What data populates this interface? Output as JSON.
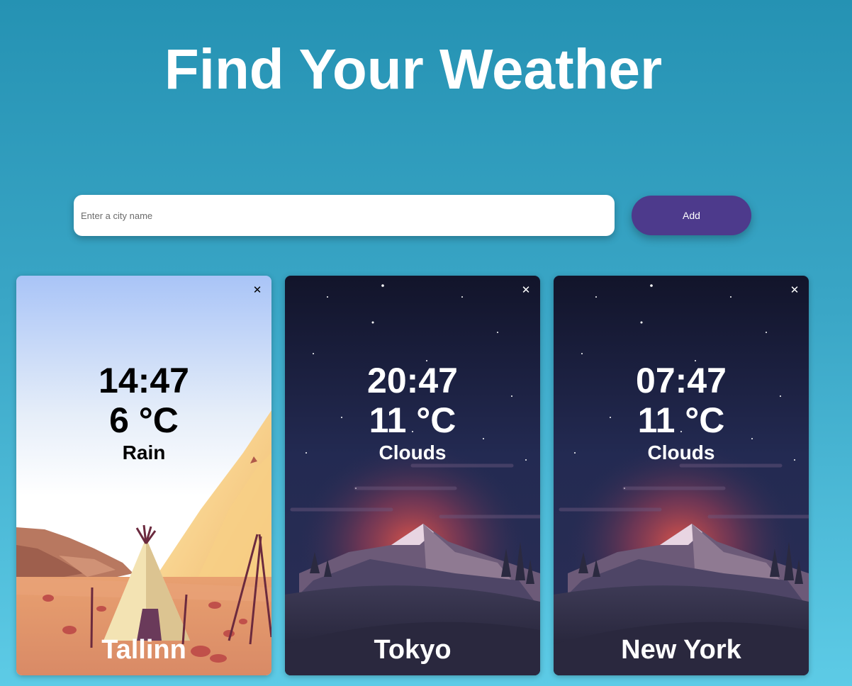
{
  "header": {
    "title": "Find Your Weather"
  },
  "search": {
    "placeholder": "Enter a city name",
    "value": "",
    "add_label": "Add"
  },
  "cards": [
    {
      "city": "Tallinn",
      "time": "14:47",
      "temperature": "6 °C",
      "condition": "Rain",
      "theme": "day",
      "close_label": "✕"
    },
    {
      "city": "Tokyo",
      "time": "20:47",
      "temperature": "11 °C",
      "condition": "Clouds",
      "theme": "night",
      "close_label": "✕"
    },
    {
      "city": "New York",
      "time": "07:47",
      "temperature": "11 °C",
      "condition": "Clouds",
      "theme": "night",
      "close_label": "✕"
    }
  ],
  "colors": {
    "add_button": "#4d3a8c",
    "background_top": "#2592b3",
    "background_bottom": "#5dcbe6"
  }
}
